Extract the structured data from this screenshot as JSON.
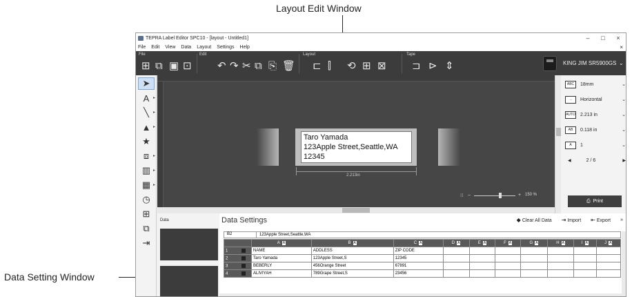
{
  "callouts": {
    "top": "Layout Edit Window",
    "left": "Data Setting Window"
  },
  "window": {
    "title": "TEPRA Label Editor SPC10 - [layout - Untitled1]",
    "min": "–",
    "max": "□",
    "close": "×"
  },
  "menu": {
    "items": [
      "File",
      "Edit",
      "View",
      "Data",
      "Layout",
      "Settings",
      "Help"
    ],
    "close": "×"
  },
  "ribbon": {
    "groups": [
      "File",
      "Edit",
      "Layout",
      "Tape"
    ],
    "printer_name": "KING JIM SR5900GS",
    "caret": "⌄"
  },
  "label": {
    "lines": [
      "Taro Yamada",
      "123Apple Street,Seattle,WA",
      "12345"
    ],
    "width_text": "2.213in"
  },
  "zoom": {
    "minus": "–",
    "plus": "+",
    "value": "150 %",
    "level": 0.6
  },
  "right_panel": {
    "tape_width": "18mm",
    "orientation": "Horizontal",
    "length": "2.213 in",
    "margin": "0.118 in",
    "copies": "1",
    "page": "2 / 6",
    "print": "Print",
    "icons": {
      "tape": "ABC",
      "orient": "→",
      "length": "AUTO",
      "margin": "AB",
      "copies": "A"
    }
  },
  "data_panel": {
    "title": "Data"
  },
  "data_settings": {
    "title": "Data Settings",
    "clear_all": "Clear All Data",
    "import": "Import",
    "export": "Export",
    "cell_ref": "B2",
    "cell_value": "123Apple Street,Seattle,WA",
    "columns": [
      "A",
      "B",
      "C",
      "D",
      "E",
      "F",
      "G",
      "H",
      "I",
      "J"
    ],
    "rows": [
      {
        "num": "1",
        "cells": [
          "NAME",
          "ADDLESS",
          "ZIP CODE",
          "",
          "",
          "",
          "",
          "",
          "",
          ""
        ]
      },
      {
        "num": "2",
        "cells": [
          "Taro Yamada",
          "123Apple Street,S",
          "12345",
          "",
          "",
          "",
          "",
          "",
          "",
          ""
        ]
      },
      {
        "num": "3",
        "cells": [
          "BEBERLY",
          "456Orange Street",
          "67891",
          "",
          "",
          "",
          "",
          "",
          "",
          ""
        ]
      },
      {
        "num": "4",
        "cells": [
          "ALIVIYAH",
          "789Grape Street,S",
          "23456",
          "",
          "",
          "",
          "",
          "",
          "",
          ""
        ]
      }
    ]
  }
}
